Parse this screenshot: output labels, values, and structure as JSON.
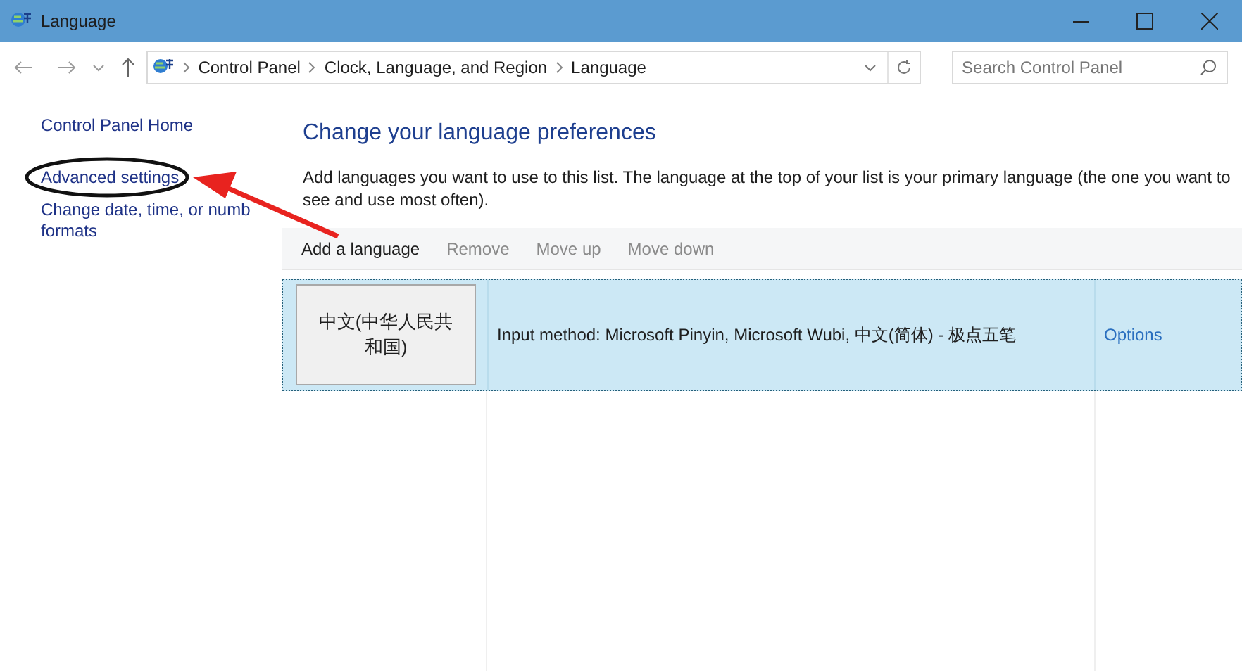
{
  "window": {
    "title": "Language"
  },
  "nav": {
    "breadcrumbs": [
      "Control Panel",
      "Clock, Language, and Region",
      "Language"
    ],
    "search": {
      "placeholder": "Search Control Panel"
    }
  },
  "sidebar": {
    "items": [
      "Control Panel Home",
      "Advanced settings",
      "Change date, time, or numb formats"
    ]
  },
  "main": {
    "heading": "Change your language preferences",
    "description": "Add languages you want to use to this list. The language at the top of your list is your primary language (the one you want to see and use most often).",
    "toolbar": [
      {
        "label": "Add a language",
        "disabled": false
      },
      {
        "label": "Remove",
        "disabled": true
      },
      {
        "label": "Move up",
        "disabled": true
      },
      {
        "label": "Move down",
        "disabled": true
      }
    ],
    "languages": [
      {
        "name": "中文(中华人民共和国)",
        "details": "Input method: Microsoft Pinyin, Microsoft Wubi, 中文(简体) - 极点五笔",
        "action": "Options",
        "selected": true
      }
    ]
  }
}
